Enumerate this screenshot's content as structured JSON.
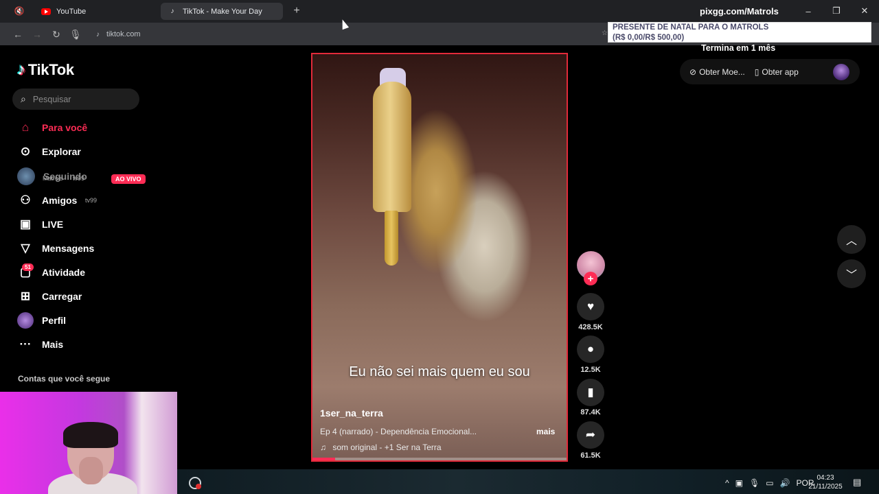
{
  "browser": {
    "tabs": [
      {
        "label": "YouTube",
        "active": false,
        "icon": "youtube-icon"
      },
      {
        "label": "TikTok - Make Your Day",
        "active": true,
        "icon": "tiktok-icon"
      }
    ],
    "url": "tiktok.com",
    "window_controls": {
      "minimize": "–",
      "restore": "❐",
      "close": "✕"
    }
  },
  "overlay": {
    "stream_url": "pixgg.com/Matrols",
    "donation_line1": "PRESENTE DE NATAL PARA O MATROLS",
    "donation_line2": "(R$ 0,00/R$ 500,00)",
    "ends_in": "Termina em 1 mês"
  },
  "header": {
    "coins_label": "Obter Moe...",
    "app_label": "Obter app"
  },
  "sidebar": {
    "logo": "TikTok",
    "search_placeholder": "Pesquisar",
    "items": [
      {
        "label": "Para você",
        "icon": "home-icon",
        "active": true
      },
      {
        "label": "Explorar",
        "icon": "compass-icon"
      },
      {
        "label": "Seguindo",
        "icon": "avatar"
      },
      {
        "label": "Amigos",
        "icon": "friends-icon"
      },
      {
        "label": "LIVE",
        "icon": "live-tv-icon"
      },
      {
        "label": "Mensagens",
        "icon": "send-icon"
      },
      {
        "label": "Atividade",
        "icon": "activity-icon",
        "badge": "51"
      },
      {
        "label": "Carregar",
        "icon": "upload-icon"
      },
      {
        "label": "Perfil",
        "icon": "profile-avatar"
      },
      {
        "label": "Mais",
        "icon": "more-icon"
      }
    ],
    "following_heading": "Contas que você segue",
    "chat_overlay": {
      "line1_name": "Matrols",
      "line1_text": "tv99",
      "live_badge": "AO VIVO",
      "line2_text": "tv99"
    }
  },
  "video": {
    "caption": "Eu não sei mais quem eu sou",
    "author": "1ser_na_terra",
    "description": "Ep 4 (narrado) - Dependência Emocional...",
    "more": "mais",
    "music": "som original - +1 Ser na Terra",
    "progress": 0.09
  },
  "actions": {
    "likes": "428.5K",
    "comments": "12.5K",
    "saves": "87.4K",
    "shares": "61.5K"
  },
  "taskbar": {
    "language": "POR",
    "time": "04:23",
    "date": "21/11/2025"
  },
  "colors": {
    "accent": "#fe2c55",
    "video_border": "#e32a3a",
    "background": "#000000"
  }
}
